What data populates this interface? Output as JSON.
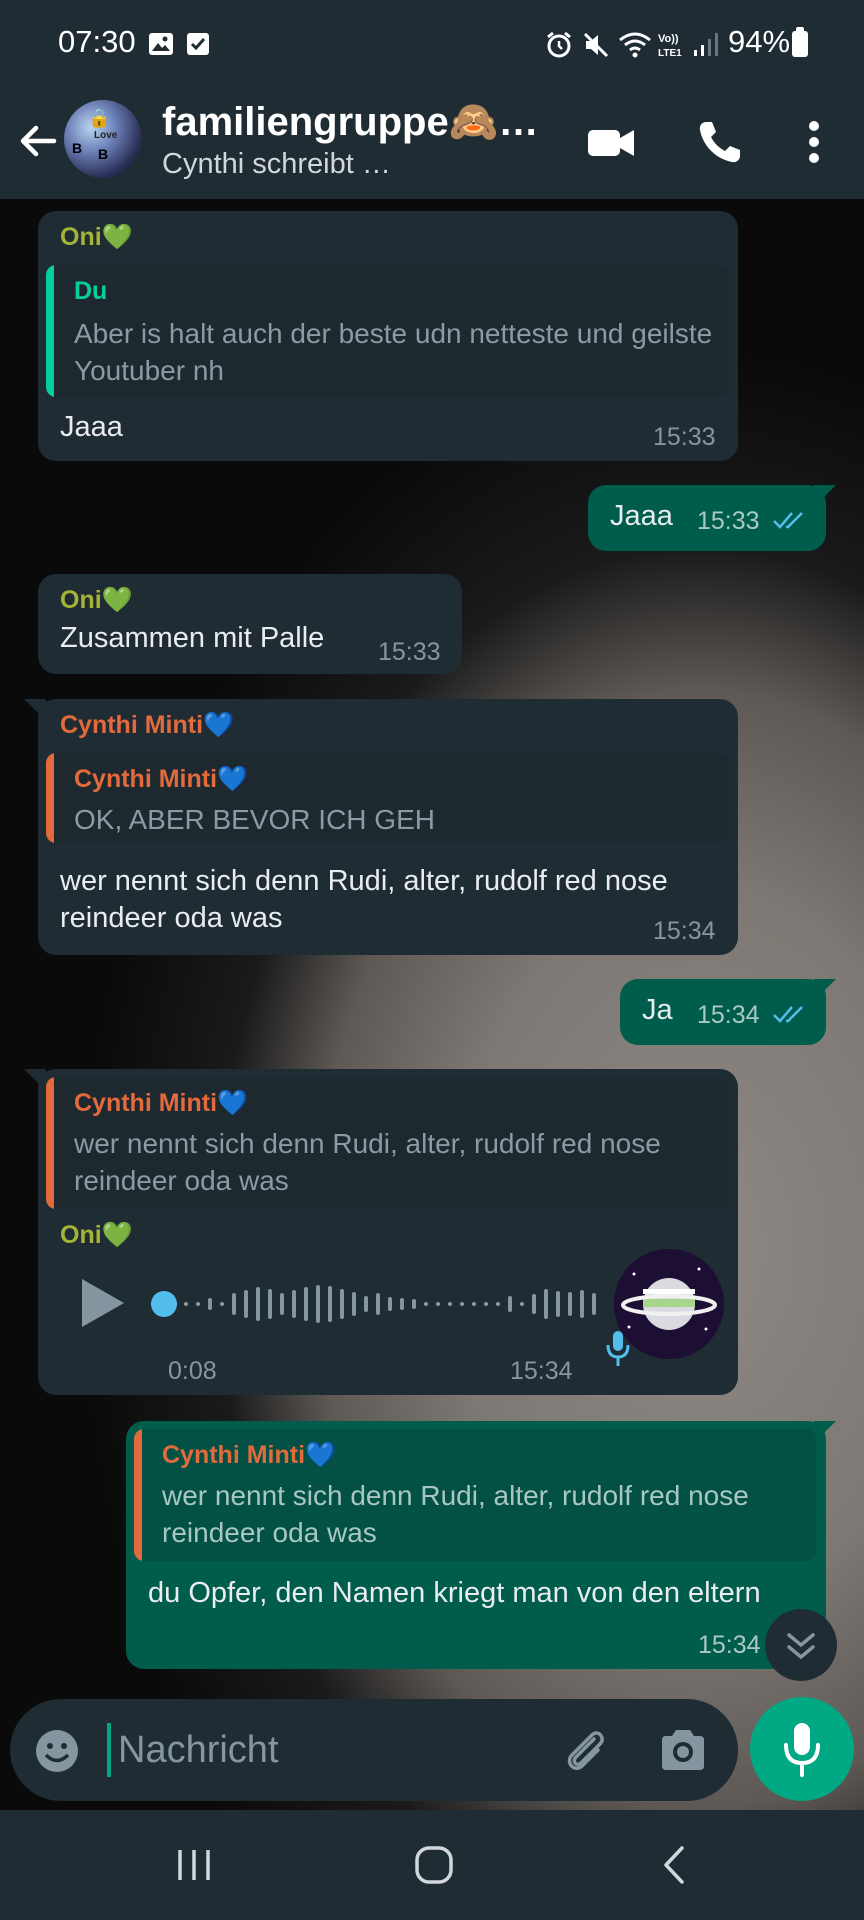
{
  "status_bar": {
    "time": "07:30",
    "battery": "94%",
    "icons": [
      "gallery-icon",
      "check-box-icon",
      "alarm-icon",
      "mute-icon",
      "wifi-icon",
      "volte-icon",
      "signal-icon",
      "battery-icon"
    ]
  },
  "header": {
    "title": "familiengruppe🙈…",
    "subtitle": "Cynthi schreibt …",
    "avatar_text": "Love"
  },
  "messages": [
    {
      "direction": "in",
      "sender": "Oni💚",
      "quote": {
        "name": "Du",
        "text": "Aber is halt auch der beste udn netteste und geilste Youtuber nh"
      },
      "text": "Jaaa",
      "time": "15:33"
    },
    {
      "direction": "out",
      "text": "Jaaa",
      "time": "15:33",
      "status": "read"
    },
    {
      "direction": "in",
      "sender": "Oni💚",
      "text": "Zusammen mit Palle",
      "time": "15:33"
    },
    {
      "direction": "in",
      "sender": "Cynthi Minti💙",
      "quote": {
        "name": "Cynthi Minti💙",
        "text": "OK, ABER BEVOR ICH GEH"
      },
      "text": "wer nennt sich denn Rudi, alter, rudolf red nose reindeer oda was",
      "time": "15:34"
    },
    {
      "direction": "out",
      "text": "Ja",
      "time": "15:34",
      "status": "read"
    },
    {
      "direction": "in",
      "quote": {
        "name": "Cynthi Minti💙",
        "text": "wer nennt sich denn Rudi, alter, rudolf red nose reindeer oda was"
      },
      "sender": "Oni💚",
      "voice": {
        "duration": "0:08",
        "progress": 0.0
      },
      "time": "15:34"
    },
    {
      "direction": "out",
      "quote": {
        "name": "Cynthi Minti💙",
        "text": "wer nennt sich denn Rudi, alter, rudolf red nose reindeer oda was"
      },
      "text": "du Opfer, den Namen kriegt man von den eltern",
      "time": "15:34"
    }
  ],
  "composer": {
    "placeholder": "Nachricht"
  },
  "colors": {
    "accent": "#00a884",
    "outgoing_bubble": "#005c4b",
    "incoming_bubble": "#1f2c34",
    "sender_oni": "#a5b337",
    "sender_cynthi": "#e26a3d",
    "read_ticks": "#53bdeb"
  }
}
